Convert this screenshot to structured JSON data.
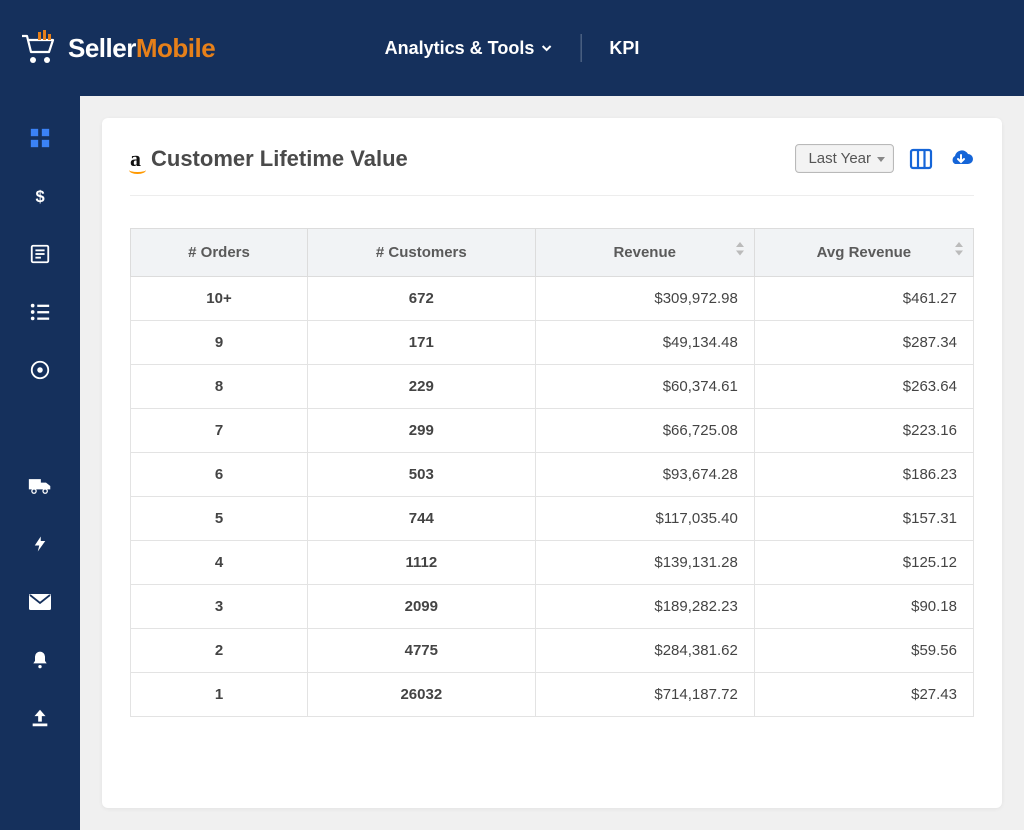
{
  "brand": {
    "first": "Seller",
    "second": "Mobile"
  },
  "nav": {
    "analytics": "Analytics & Tools",
    "kpi": "KPI"
  },
  "card": {
    "title": "Customer Lifetime Value",
    "date_range": "Last Year"
  },
  "table": {
    "headers": {
      "orders": "# Orders",
      "customers": "# Customers",
      "revenue": "Revenue",
      "avg_revenue": "Avg Revenue"
    },
    "rows": [
      {
        "orders": "10+",
        "customers": "672",
        "revenue": "$309,972.98",
        "avg_revenue": "$461.27"
      },
      {
        "orders": "9",
        "customers": "171",
        "revenue": "$49,134.48",
        "avg_revenue": "$287.34"
      },
      {
        "orders": "8",
        "customers": "229",
        "revenue": "$60,374.61",
        "avg_revenue": "$263.64"
      },
      {
        "orders": "7",
        "customers": "299",
        "revenue": "$66,725.08",
        "avg_revenue": "$223.16"
      },
      {
        "orders": "6",
        "customers": "503",
        "revenue": "$93,674.28",
        "avg_revenue": "$186.23"
      },
      {
        "orders": "5",
        "customers": "744",
        "revenue": "$117,035.40",
        "avg_revenue": "$157.31"
      },
      {
        "orders": "4",
        "customers": "1112",
        "revenue": "$139,131.28",
        "avg_revenue": "$125.12"
      },
      {
        "orders": "3",
        "customers": "2099",
        "revenue": "$189,282.23",
        "avg_revenue": "$90.18"
      },
      {
        "orders": "2",
        "customers": "4775",
        "revenue": "$284,381.62",
        "avg_revenue": "$59.56"
      },
      {
        "orders": "1",
        "customers": "26032",
        "revenue": "$714,187.72",
        "avg_revenue": "$27.43"
      }
    ]
  }
}
